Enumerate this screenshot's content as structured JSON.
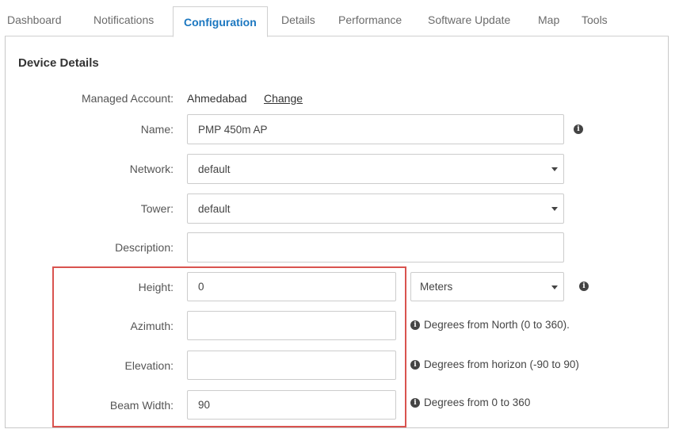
{
  "tabs": [
    {
      "label": "Dashboard"
    },
    {
      "label": "Notifications"
    },
    {
      "label": "Configuration",
      "active": true
    },
    {
      "label": "Details"
    },
    {
      "label": "Performance"
    },
    {
      "label": "Software Update"
    },
    {
      "label": "Map"
    },
    {
      "label": "Tools"
    }
  ],
  "section": {
    "title": "Device Details"
  },
  "managed_account": {
    "label": "Managed Account:",
    "value": "Ahmedabad",
    "change_link": "Change"
  },
  "fields": {
    "name": {
      "label": "Name:",
      "value": "PMP 450m AP"
    },
    "network": {
      "label": "Network:",
      "value": "default"
    },
    "tower": {
      "label": "Tower:",
      "value": "default"
    },
    "description": {
      "label": "Description:",
      "value": ""
    },
    "height": {
      "label": "Height:",
      "value": "0",
      "unit": "Meters"
    },
    "azimuth": {
      "label": "Azimuth:",
      "value": "",
      "hint": "Degrees from North (0 to 360)."
    },
    "elevation": {
      "label": "Elevation:",
      "value": "",
      "hint": "Degrees from horizon (-90 to 90)"
    },
    "beam_width": {
      "label": "Beam Width:",
      "value": "90",
      "hint": "Degrees from 0 to 360"
    }
  },
  "colors": {
    "accent": "#1b77c0",
    "highlight": "#d9534f"
  },
  "icons": {
    "info": "info-circle-icon",
    "dropdown": "chevron-down-icon"
  }
}
